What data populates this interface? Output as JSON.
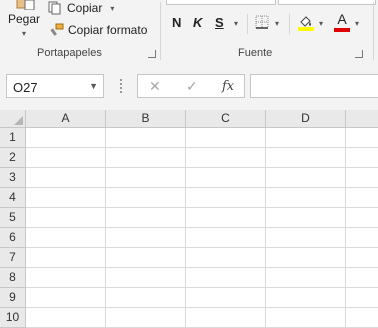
{
  "ribbon": {
    "clipboard": {
      "paste_label": "Pegar",
      "copy_label": "Copiar",
      "format_painter_label": "Copiar formato",
      "group_label": "Portapapeles"
    },
    "font": {
      "bold_label": "N",
      "italic_label": "K",
      "underline_label": "S",
      "font_color_letter": "A",
      "group_label": "Fuente"
    },
    "colors": {
      "highlight": "#ffff00",
      "font_color": "#e00000"
    }
  },
  "formula_bar": {
    "name_box_value": "O27",
    "cancel_symbol": "✕",
    "enter_symbol": "✓",
    "fx_label": "fx",
    "formula_value": ""
  },
  "grid": {
    "columns": [
      "A",
      "B",
      "C",
      "D"
    ],
    "rows": [
      "1",
      "2",
      "3",
      "4",
      "5",
      "6",
      "7",
      "8",
      "9",
      "10"
    ]
  }
}
